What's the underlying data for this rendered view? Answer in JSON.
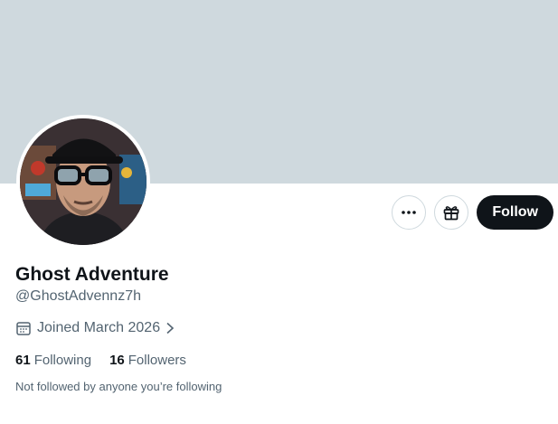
{
  "profile": {
    "display_name": "Ghost Adventure",
    "handle": "@GhostAdvennz7h",
    "joined": "Joined March 2026",
    "following_count": "61",
    "following_label": "Following",
    "followers_count": "16",
    "followers_label": "Followers",
    "not_followed_text": "Not followed by anyone you’re following"
  },
  "actions": {
    "follow_label": "Follow",
    "more_icon": "more-horizontal-icon",
    "subscribe_icon": "gift-icon"
  },
  "colors": {
    "banner": "#cfd9de",
    "primary_text": "#0f1419",
    "secondary_text": "#536471",
    "follow_bg": "#0f1419"
  }
}
